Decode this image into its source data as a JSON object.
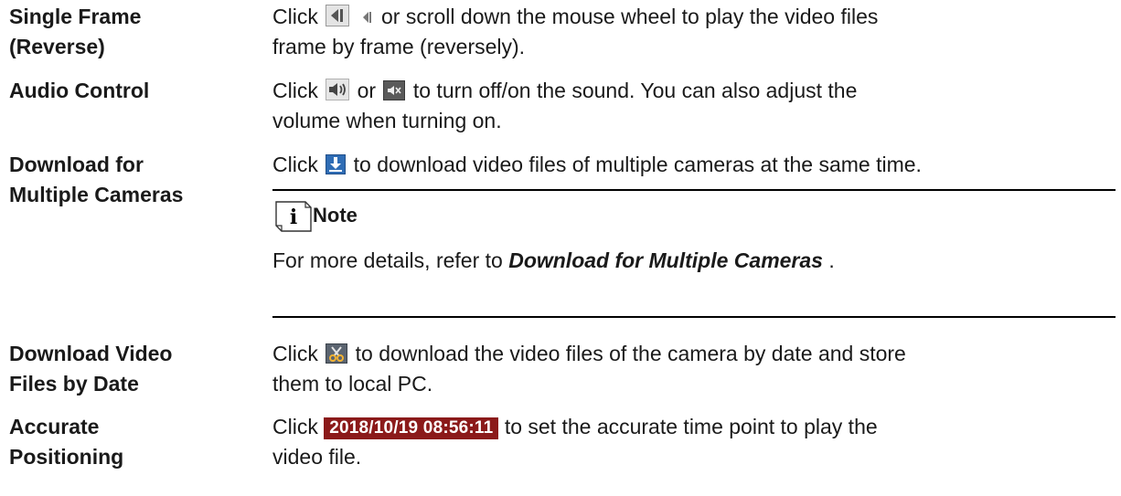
{
  "rows": [
    {
      "term": [
        "Single Frame",
        "(Reverse)"
      ],
      "desc_a": "Click",
      "desc_b": "or scroll down the mouse wheel to play the video files",
      "desc_c": "frame by frame (reversely)."
    },
    {
      "term": [
        "Audio Control"
      ],
      "desc_a": "Click",
      "desc_b": "or",
      "desc_c": "to turn off/on the sound. You can also adjust the",
      "desc_d": "volume when turning on."
    },
    {
      "term": [
        "Download for",
        "Multiple Cameras"
      ],
      "desc_a": "Click",
      "desc_b": "to download video files of multiple cameras at the same time.",
      "note": {
        "title": "Note",
        "text_a": "For more details, refer to",
        "link": "Download for Multiple Cameras",
        "text_b": "."
      }
    },
    {
      "term": [
        "Download Video",
        "Files by Date"
      ],
      "desc_a": "Click",
      "desc_b": "to download the video files of the camera by date and store",
      "desc_c": "them to local PC."
    },
    {
      "term": [
        "Accurate",
        "Positioning"
      ],
      "desc_a": "Click",
      "time_chip": "2018/10/19 08:56:11",
      "desc_b": "to set the accurate time point to play the",
      "desc_c": "video file."
    }
  ],
  "icons": {
    "frame_back": "single-frame-reverse-icon",
    "frame_back_small": "frame-back-small-icon",
    "audio_on": "speaker-on-icon",
    "audio_off": "speaker-mute-icon",
    "download": "download-icon",
    "clip": "scissors-icon"
  },
  "colors": {
    "time_chip_bg": "#8b1a1a",
    "download_icon": "#2f6db5"
  }
}
